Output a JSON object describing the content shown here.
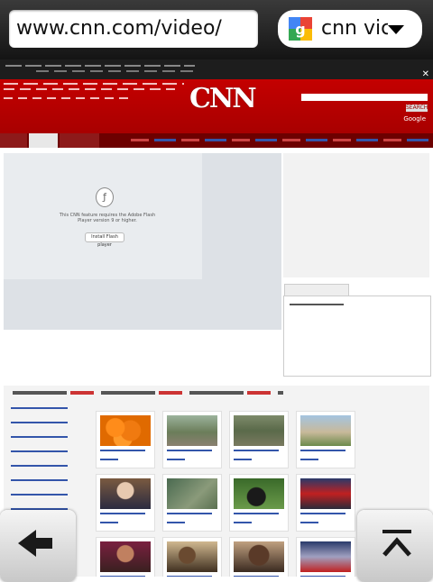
{
  "browser": {
    "url": "www.cnn.com/video/",
    "search_query": "cnn vic",
    "search_engine_icon": "google-icon"
  },
  "page": {
    "site_logo": "CNN",
    "search_button": "SEARCH",
    "powered_by": "Google",
    "flash_message": "This CNN feature requires the Adobe Flash Player version 9 or higher.",
    "flash_button": "Install Flash player"
  },
  "bottom_nav": {
    "back_icon": "arrow-left-icon",
    "top_icon": "scroll-to-top-icon"
  }
}
